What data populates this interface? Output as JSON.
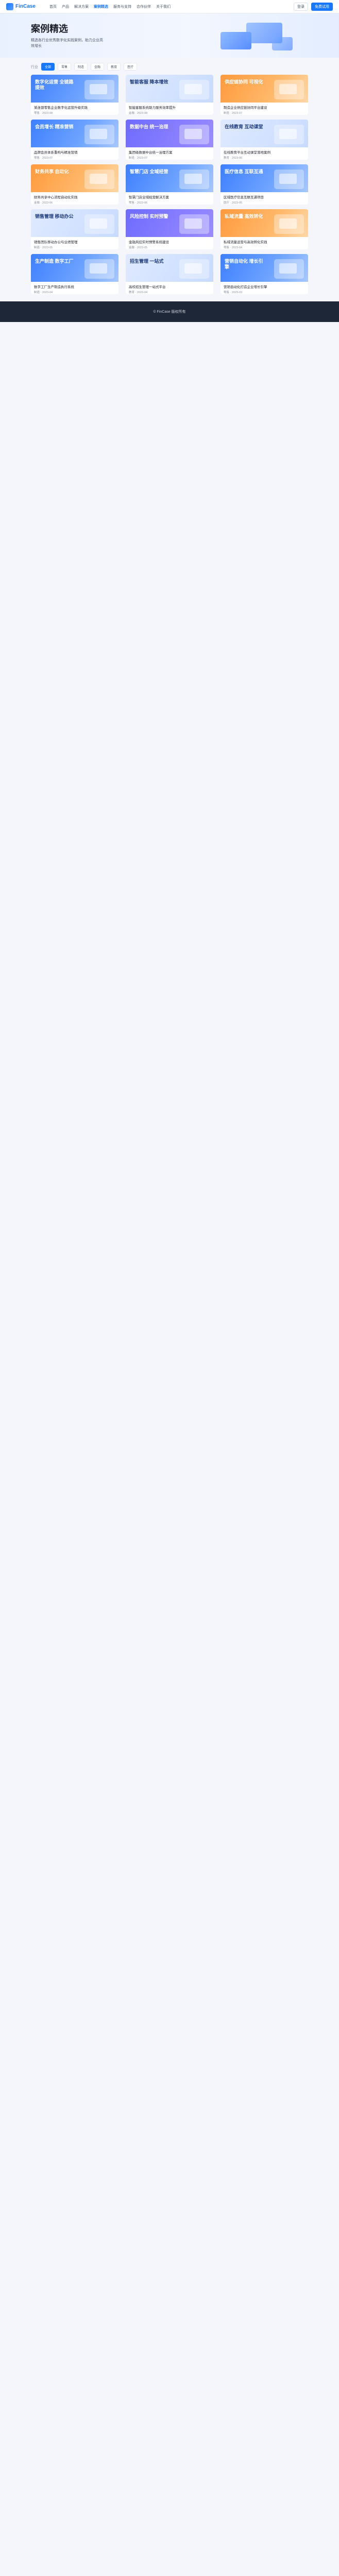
{
  "nav": {
    "logo": "FinCase",
    "items": [
      "首页",
      "产品",
      "解决方案",
      "案例精选",
      "服务与支持",
      "合作伙伴",
      "关于我们"
    ],
    "active_index": 3,
    "login": "登录",
    "signup": "免费试用"
  },
  "hero": {
    "title": "案例精选",
    "desc": "精选各行业优秀数字化实践案例，助力企业高效增长"
  },
  "filters": {
    "label": "行业",
    "chips": [
      "全部",
      "零售",
      "制造",
      "金融",
      "教育",
      "医疗"
    ]
  },
  "cards": [
    {
      "thumb": "数字化运营 全链路提效",
      "title": "某连锁零售企业数字化运营升级实践",
      "meta": "零售 · 2023-08",
      "style": "blue"
    },
    {
      "thumb": "智能客服 降本增效",
      "title": "智能客服系统助力服务效率提升",
      "meta": "金融 · 2023-08",
      "style": "light"
    },
    {
      "thumb": "供应链协同 可视化",
      "title": "制造企业供应链协同平台建设",
      "meta": "制造 · 2023-07",
      "style": "orange"
    },
    {
      "thumb": "会员增长 精准营销",
      "title": "品牌会员体系重构与精准营销",
      "meta": "零售 · 2023-07",
      "style": "blue"
    },
    {
      "thumb": "数据中台 统一治理",
      "title": "集团级数据中台统一治理方案",
      "meta": "制造 · 2023-07",
      "style": "purple"
    },
    {
      "thumb": "在线教育 互动课堂",
      "title": "在线教育平台互动课堂落地案例",
      "meta": "教育 · 2023-06",
      "style": "light"
    },
    {
      "thumb": "财务共享 自动化",
      "title": "财务共享中心流程自动化实践",
      "meta": "金融 · 2023-06",
      "style": "orange"
    },
    {
      "thumb": "智慧门店 全域经营",
      "title": "智慧门店全域经营解决方案",
      "meta": "零售 · 2023-06",
      "style": "blue"
    },
    {
      "thumb": "医疗信息 互联互通",
      "title": "区域医疗信息互联互通项目",
      "meta": "医疗 · 2023-05",
      "style": "blue"
    },
    {
      "thumb": "销售管理 移动办公",
      "title": "销售团队移动办公与业绩管理",
      "meta": "制造 · 2023-05",
      "style": "light"
    },
    {
      "thumb": "风险控制 实时预警",
      "title": "金融风控实时预警系统建设",
      "meta": "金融 · 2023-05",
      "style": "purple"
    },
    {
      "thumb": "私域流量 高效转化",
      "title": "私域流量运营与高效转化实践",
      "meta": "零售 · 2023-04",
      "style": "orange"
    },
    {
      "thumb": "生产制造 数字工厂",
      "title": "数字工厂生产制造执行系统",
      "meta": "制造 · 2023-04",
      "style": "blue"
    },
    {
      "thumb": "招生管理 一站式",
      "title": "高校招生管理一站式平台",
      "meta": "教育 · 2023-04",
      "style": "light"
    },
    {
      "thumb": "营销自动化 增长引擎",
      "title": "营销自动化打造企业增长引擎",
      "meta": "零售 · 2023-03",
      "style": "blue"
    }
  ],
  "footer": {
    "text": "© FinCase 版权所有"
  }
}
